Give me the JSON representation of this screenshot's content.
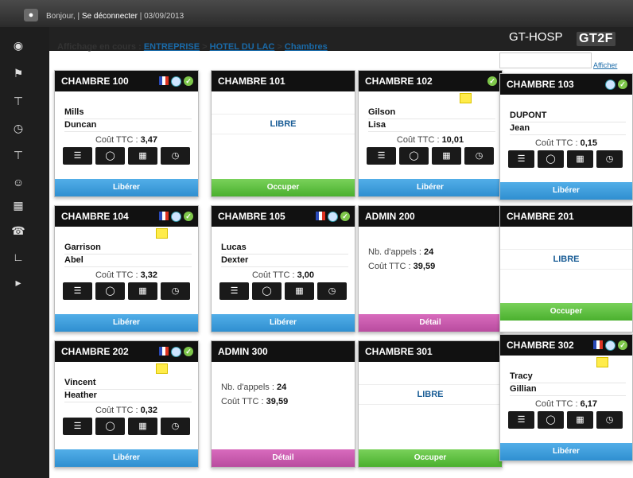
{
  "header": {
    "greeting": "Bonjour,",
    "separator": "|",
    "logout": "Se déconnecter",
    "date": "| 03/09/2013",
    "app_name": "GT-HOSP",
    "logo": "GT2F"
  },
  "breadcrumb": {
    "label": "Affichage en cours :",
    "level1": "ENTREPRISE",
    "sep": ">",
    "level2": "HOTEL DU LAC",
    "level3": "Chambres"
  },
  "search": {
    "button": "Afficher",
    "value": ""
  },
  "sidebar": [
    "dashboard-icon",
    "flag-icon",
    "hammer-icon",
    "clock-icon",
    "hammer-icon",
    "user-icon",
    "building-icon",
    "phone-icon",
    "chart-icon",
    "arrow-icon"
  ],
  "labels": {
    "cost": "Coût TTC :",
    "calls": "Nb. d'appels :",
    "free": "LIBRE",
    "liberer": "Libérer",
    "occuper": "Occuper",
    "detail": "Détail"
  },
  "cards": [
    {
      "title": "CHAMBRE 100",
      "type": "room",
      "last": "Mills",
      "first": "Duncan",
      "cost": "3,47",
      "button": "Libérer"
    },
    {
      "title": "CHAMBRE 101",
      "type": "free",
      "button": "Occuper"
    },
    {
      "title": "CHAMBRE 102",
      "type": "room",
      "last": "Gilson",
      "first": "Lisa",
      "cost": "10,01",
      "button": "Libérer"
    },
    {
      "title": "CHAMBRE 103",
      "type": "room",
      "last": "DUPONT",
      "first": "Jean",
      "cost": "0,15",
      "button": "Libérer"
    },
    {
      "title": "CHAMBRE 104",
      "type": "room",
      "last": "Garrison",
      "first": "Abel",
      "cost": "3,32",
      "button": "Libérer"
    },
    {
      "title": "CHAMBRE 105",
      "type": "room",
      "last": "Lucas",
      "first": "Dexter",
      "cost": "3,00",
      "button": "Libérer"
    },
    {
      "title": "ADMIN 200",
      "type": "admin",
      "calls": "24",
      "cost": "39,59",
      "button": "Détail"
    },
    {
      "title": "CHAMBRE 201",
      "type": "free",
      "button": "Occuper"
    },
    {
      "title": "CHAMBRE 202",
      "type": "room",
      "last": "Vincent",
      "first": "Heather",
      "cost": "0,32",
      "button": "Libérer"
    },
    {
      "title": "ADMIN 300",
      "type": "admin",
      "calls": "24",
      "cost": "39,59",
      "button": "Détail"
    },
    {
      "title": "CHAMBRE 301",
      "type": "free",
      "button": "Occuper"
    },
    {
      "title": "CHAMBRE 302",
      "type": "room",
      "last": "Tracy",
      "first": "Gillian",
      "cost": "6,17",
      "button": "Libérer"
    }
  ]
}
